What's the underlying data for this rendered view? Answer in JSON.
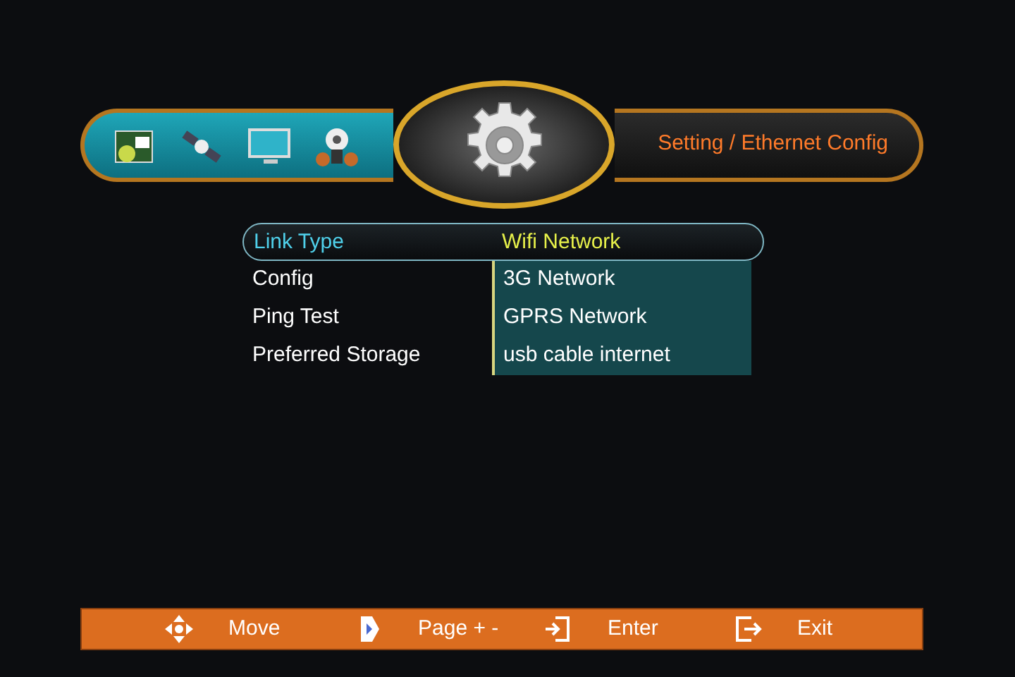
{
  "header": {
    "title": "Setting / Ethernet Config"
  },
  "menu": {
    "items": [
      {
        "label": "Link Type",
        "selected": true
      },
      {
        "label": "Config",
        "selected": false
      },
      {
        "label": "Ping Test",
        "selected": false
      },
      {
        "label": "Preferred Storage",
        "selected": false
      }
    ]
  },
  "dropdown": {
    "options": [
      {
        "label": "Wifi Network",
        "selected": true
      },
      {
        "label": "3G Network",
        "selected": false
      },
      {
        "label": "GPRS Network",
        "selected": false
      },
      {
        "label": "usb cable internet",
        "selected": false
      }
    ]
  },
  "footer": {
    "hints": [
      {
        "kind": "move",
        "label": "Move"
      },
      {
        "kind": "page",
        "label": "Page + -"
      },
      {
        "kind": "enter",
        "label": "Enter"
      },
      {
        "kind": "exit",
        "label": "Exit"
      }
    ]
  }
}
